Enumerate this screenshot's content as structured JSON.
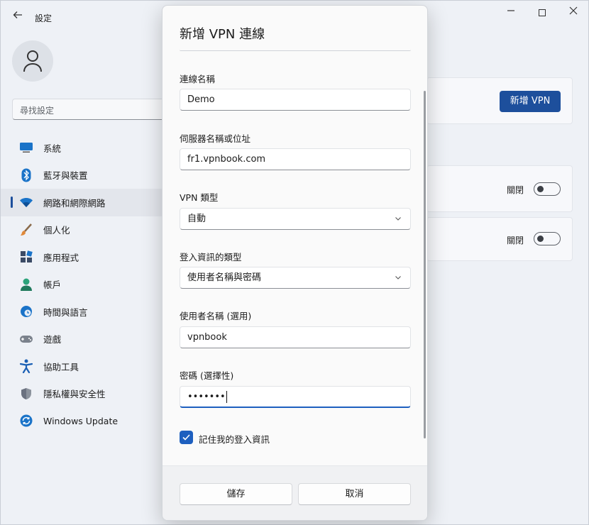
{
  "window": {
    "title": "設定",
    "back_icon": "arrow-left-icon",
    "controls": [
      "minimize-icon",
      "maximize-icon",
      "close-icon"
    ]
  },
  "sidebar": {
    "search_placeholder": "尋找設定",
    "items": [
      {
        "label": "系統",
        "icon": "monitor-icon",
        "color": "#1a73c8"
      },
      {
        "label": "藍牙與裝置",
        "icon": "bluetooth-icon",
        "color": "#1a73c8"
      },
      {
        "label": "網路和網際網路",
        "icon": "wifi-icon",
        "color": "#1a73c8",
        "selected": true
      },
      {
        "label": "個人化",
        "icon": "brush-icon",
        "color": "#c8772a"
      },
      {
        "label": "應用程式",
        "icon": "apps-icon",
        "color": "#4a5d7a"
      },
      {
        "label": "帳戶",
        "icon": "person-icon",
        "color": "#2ba37a"
      },
      {
        "label": "時間與語言",
        "icon": "clock-globe-icon",
        "color": "#1a73c8"
      },
      {
        "label": "遊戲",
        "icon": "gamepad-icon",
        "color": "#6b7280"
      },
      {
        "label": "協助工具",
        "icon": "accessibility-icon",
        "color": "#1a5fb4"
      },
      {
        "label": "隱私權與安全性",
        "icon": "shield-icon",
        "color": "#6b7280"
      },
      {
        "label": "Windows Update",
        "icon": "update-icon",
        "color": "#1a73c8"
      }
    ]
  },
  "main": {
    "add_vpn_label": "新增 VPN",
    "toggle_rows": [
      {
        "label": "關閉",
        "on": false
      },
      {
        "label": "關閉",
        "on": false
      }
    ]
  },
  "dialog": {
    "title": "新增 VPN 連線",
    "fields": {
      "connection_name": {
        "label": "連線名稱",
        "value": "Demo"
      },
      "server": {
        "label": "伺服器名稱或位址",
        "value": "fr1.vpnbook.com"
      },
      "vpn_type": {
        "label": "VPN 類型",
        "value": "自動"
      },
      "signin_type": {
        "label": "登入資訊的類型",
        "value": "使用者名稱與密碼"
      },
      "username": {
        "label": "使用者名稱 (選用)",
        "value": "vpnbook"
      },
      "password": {
        "label": "密碼 (選擇性)",
        "value": "•••••••"
      }
    },
    "remember": {
      "label": "記住我的登入資訊",
      "checked": true
    },
    "save_label": "儲存",
    "cancel_label": "取消"
  },
  "colors": {
    "accent": "#1d4f9c",
    "focus": "#1d5fbf"
  }
}
